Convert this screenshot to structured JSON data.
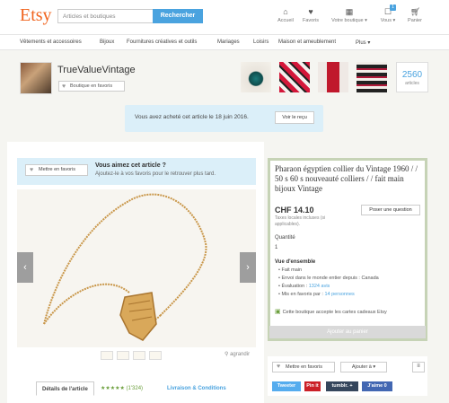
{
  "header": {
    "logo": "Etsy",
    "search_placeholder": "Articles et boutiques",
    "search_button": "Rechercher",
    "nav": [
      {
        "label": "Accueil",
        "icon": "home-icon"
      },
      {
        "label": "Favoris",
        "icon": "heart-icon"
      },
      {
        "label": "Votre boutique ▾",
        "icon": "shop-icon"
      },
      {
        "label": "Vous ▾",
        "icon": "user-icon",
        "badge": "1"
      },
      {
        "label": "Panier",
        "icon": "cart-icon"
      }
    ]
  },
  "categories": [
    "Vêtements et accessoires",
    "Bijoux",
    "Fournitures créatives et outils",
    "Mariages",
    "Loisirs",
    "Maison et ameublement",
    "Plus ▾"
  ],
  "shop": {
    "name": "TrueValueVintage",
    "favorite_button": "Boutique en favoris",
    "article_count": "2560",
    "article_label": "articles"
  },
  "purchase_notice": {
    "text": "Vous avez acheté cet article le 18 juin 2016.",
    "button": "Voir le reçu"
  },
  "favorite_banner": {
    "button": "Mettre en favoris",
    "question": "Vous aimez cet article ?",
    "subtext": "Ajoutez-le à vos favoris pour le retrouver plus tard."
  },
  "image_controls": {
    "zoom": "agrandir"
  },
  "tabs": [
    {
      "label": "Détails de l'article"
    },
    {
      "label": "★★★★★ (1'324)"
    },
    {
      "label": "Livraison & Conditions"
    }
  ],
  "listing": {
    "title": "Pharaon égyptien collier du Vintage 1960 / / 50 s 60 s nouveauté colliers / / fait main bijoux Vintage",
    "price": "CHF 14.10",
    "taxes": "Taxes locales incluses (si applicables).",
    "ask_button": "Poser une question",
    "quantity_label": "Quantité",
    "quantity_value": "1",
    "overview_title": "Vue d'ensemble",
    "overview": [
      {
        "text": "Fait main",
        "link": ""
      },
      {
        "text": "Envoi dans le monde entier depuis : Canada",
        "link": ""
      },
      {
        "text": "Évaluation : ",
        "link": "1324 avis"
      },
      {
        "text": "Mis en favoris par : ",
        "link": "14 personnes"
      }
    ],
    "gift_text": "Cette boutique accepte les cartes cadeaux Etsy",
    "cart_button": "Ajouter au panier"
  },
  "share": {
    "favorite_button": "Mettre en favoris",
    "add_to": "Ajouter à ▾",
    "more": "≡",
    "buttons": [
      {
        "label": "Tweeter",
        "color": "#55acee"
      },
      {
        "label": "Pin it",
        "color": "#cb2027"
      },
      {
        "label": "tumblr. +",
        "color": "#35465c"
      },
      {
        "label": "J'aime 0",
        "color": "#4267b2"
      }
    ]
  },
  "colors": {
    "accent": "#f1641e",
    "link": "#4aa3df"
  }
}
